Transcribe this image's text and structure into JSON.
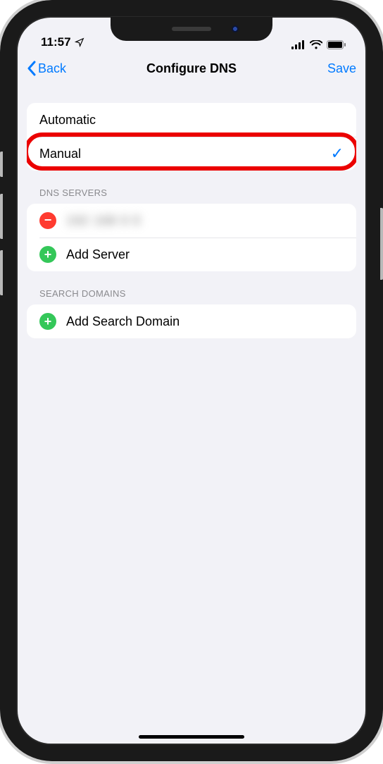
{
  "status": {
    "time": "11:57",
    "location_icon": "location-arrow-icon",
    "signal_icon": "cellular-signal-icon",
    "wifi_icon": "wifi-icon",
    "battery_icon": "battery-icon"
  },
  "nav": {
    "back_label": "Back",
    "title": "Configure DNS",
    "save_label": "Save"
  },
  "dns_mode": {
    "options": [
      {
        "label": "Automatic",
        "selected": false
      },
      {
        "label": "Manual",
        "selected": true
      }
    ],
    "highlighted_index": 1
  },
  "sections": {
    "dns_servers": {
      "header": "DNS SERVERS",
      "servers": [
        {
          "value": "obscured",
          "display": "192 168 0 0"
        }
      ],
      "add_label": "Add Server"
    },
    "search_domains": {
      "header": "SEARCH DOMAINS",
      "add_label": "Add Search Domain"
    }
  },
  "colors": {
    "accent": "#007aff",
    "remove": "#ff3b30",
    "add": "#34c759",
    "bg": "#f2f2f7",
    "highlight": "#eb0000"
  }
}
